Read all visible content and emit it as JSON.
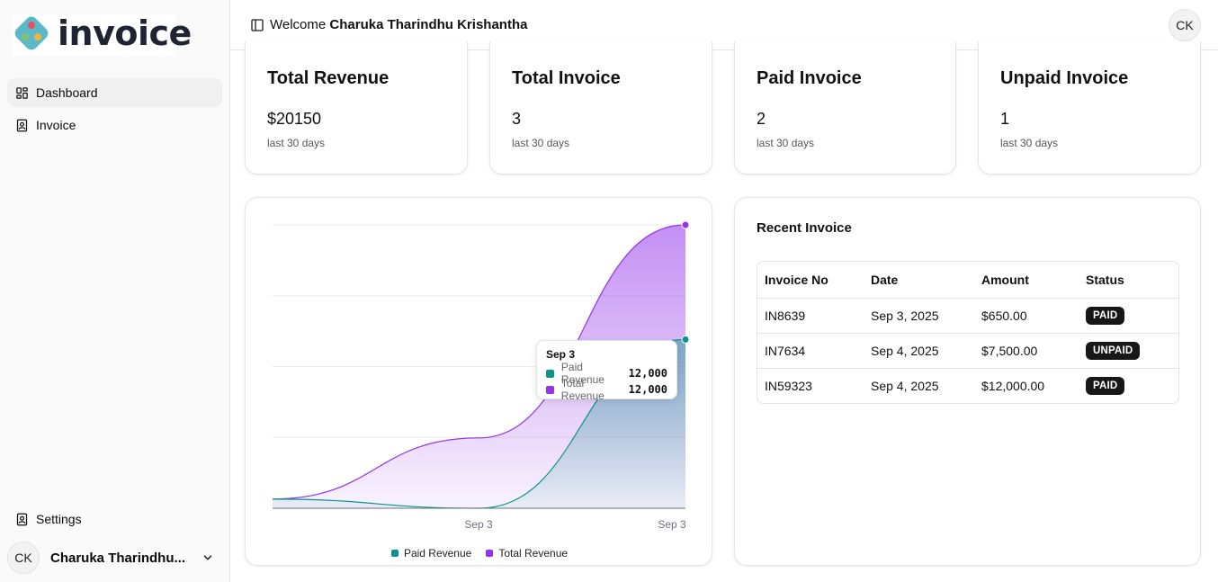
{
  "app": {
    "logo_text": "invoice"
  },
  "sidebar": {
    "items": [
      {
        "label": "Dashboard",
        "icon": "dashboard-icon"
      },
      {
        "label": "Invoice",
        "icon": "invoice-icon"
      }
    ],
    "settings_label": "Settings",
    "user": {
      "initials": "CK",
      "name": "Charuka Tharindhu..."
    }
  },
  "header": {
    "welcome_prefix": "Welcome",
    "user_name": "Charuka Tharindhu Krishantha",
    "avatar_initials": "CK"
  },
  "stats": [
    {
      "title": "Total Revenue",
      "value": "$20150",
      "sub": "last 30 days"
    },
    {
      "title": "Total Invoice",
      "value": "3",
      "sub": "last 30 days"
    },
    {
      "title": "Paid Invoice",
      "value": "2",
      "sub": "last 30 days"
    },
    {
      "title": "Unpaid Invoice",
      "value": "1",
      "sub": "last 30 days"
    }
  ],
  "chart_data": {
    "type": "area",
    "x": [
      "Sep 3",
      "Sep 3",
      "Sep 3"
    ],
    "x_tick_labels": [
      "Sep 3",
      "Sep 3"
    ],
    "series": [
      {
        "name": "Paid Revenue",
        "color": "#0d9488",
        "values": [
          650,
          0,
          12000
        ]
      },
      {
        "name": "Total Revenue",
        "color": "#9333ea",
        "values": [
          650,
          5000,
          20150
        ]
      }
    ],
    "ylim": [
      0,
      20150
    ],
    "grid": true,
    "legend": "bottom",
    "tooltip": {
      "title": "Sep 3",
      "rows": [
        {
          "name": "Paid Revenue",
          "value": "12,000"
        },
        {
          "name": "Total Revenue",
          "value": "12,000"
        }
      ]
    }
  },
  "recent": {
    "title": "Recent Invoice",
    "columns": [
      "Invoice No",
      "Date",
      "Amount",
      "Status"
    ],
    "rows": [
      {
        "no": "IN8639",
        "date": "Sep 3, 2025",
        "amount": "$650.00",
        "status": "PAID"
      },
      {
        "no": "IN7634",
        "date": "Sep 4, 2025",
        "amount": "$7,500.00",
        "status": "UNPAID"
      },
      {
        "no": "IN59323",
        "date": "Sep 4, 2025",
        "amount": "$12,000.00",
        "status": "PAID"
      }
    ]
  }
}
